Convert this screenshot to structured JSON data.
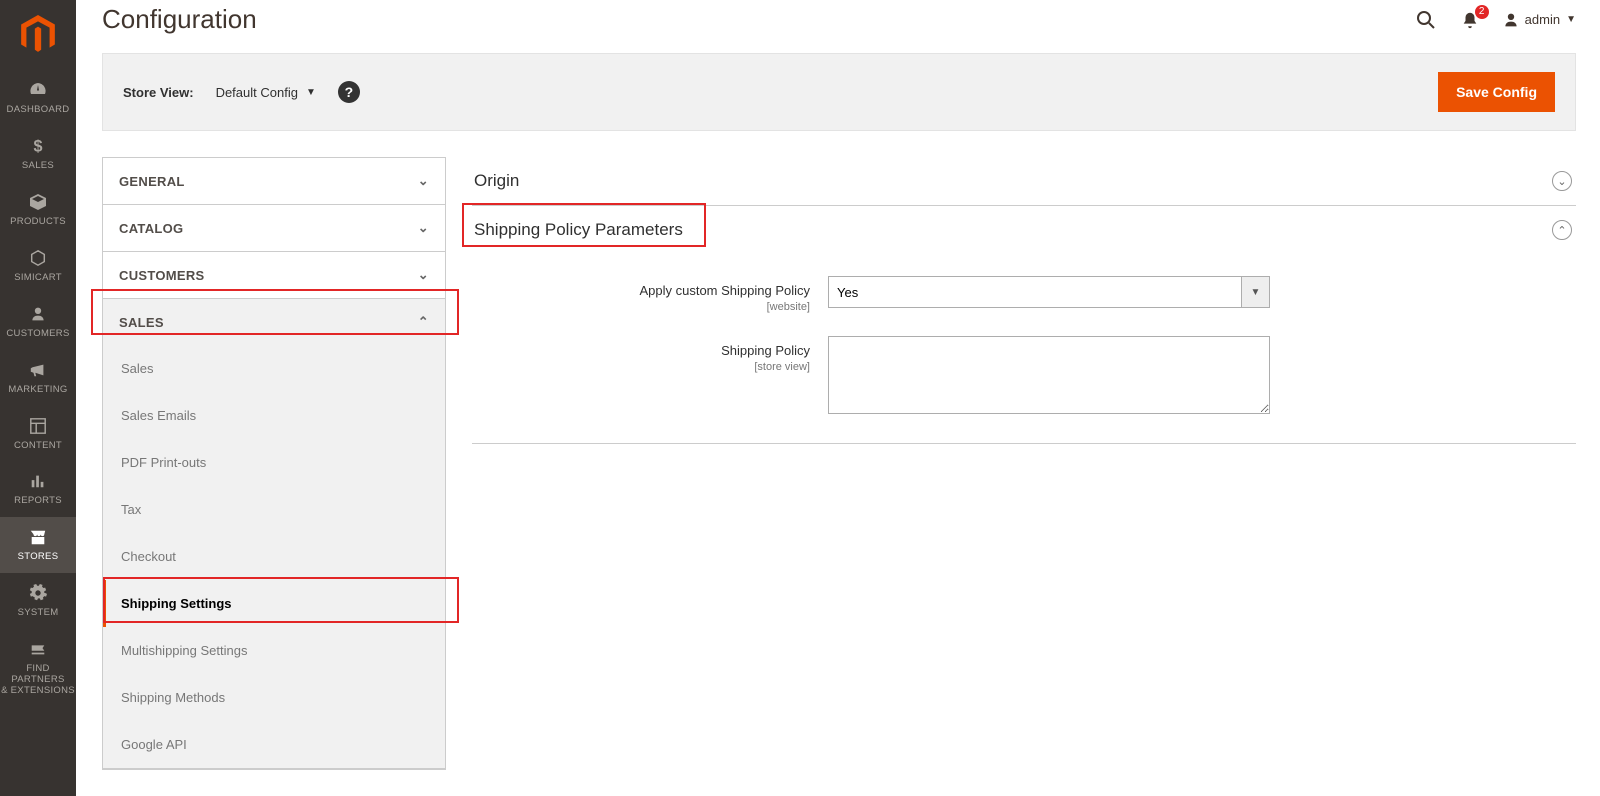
{
  "admin": {
    "name": "admin"
  },
  "notifications": {
    "count": "2"
  },
  "page": {
    "title": "Configuration"
  },
  "storeview": {
    "label": "Store View:",
    "value": "Default Config"
  },
  "actions": {
    "save": "Save Config"
  },
  "sidenav": [
    {
      "key": "dashboard",
      "label": "DASHBOARD"
    },
    {
      "key": "sales",
      "label": "SALES"
    },
    {
      "key": "products",
      "label": "PRODUCTS"
    },
    {
      "key": "simicart",
      "label": "SIMICART"
    },
    {
      "key": "customers",
      "label": "CUSTOMERS"
    },
    {
      "key": "marketing",
      "label": "MARKETING"
    },
    {
      "key": "content",
      "label": "CONTENT"
    },
    {
      "key": "reports",
      "label": "REPORTS"
    },
    {
      "key": "stores",
      "label": "STORES"
    },
    {
      "key": "system",
      "label": "SYSTEM"
    },
    {
      "key": "partners",
      "label": "FIND PARTNERS\n& EXTENSIONS"
    }
  ],
  "config_nav": {
    "groups": [
      {
        "label": "GENERAL",
        "expanded": false
      },
      {
        "label": "CATALOG",
        "expanded": false
      },
      {
        "label": "CUSTOMERS",
        "expanded": false
      },
      {
        "label": "SALES",
        "expanded": true,
        "items": [
          {
            "label": "Sales"
          },
          {
            "label": "Sales Emails"
          },
          {
            "label": "PDF Print-outs"
          },
          {
            "label": "Tax"
          },
          {
            "label": "Checkout"
          },
          {
            "label": "Shipping Settings",
            "active": true
          },
          {
            "label": "Multishipping Settings"
          },
          {
            "label": "Shipping Methods"
          },
          {
            "label": "Google API"
          }
        ]
      }
    ]
  },
  "sections": {
    "origin": {
      "title": "Origin",
      "expanded": false
    },
    "shipping_policy": {
      "title": "Shipping Policy Parameters",
      "expanded": true,
      "fields": {
        "apply_custom": {
          "label": "Apply custom Shipping Policy",
          "scope": "[website]",
          "value": "Yes"
        },
        "policy": {
          "label": "Shipping Policy",
          "scope": "[store view]",
          "value": ""
        }
      }
    }
  }
}
